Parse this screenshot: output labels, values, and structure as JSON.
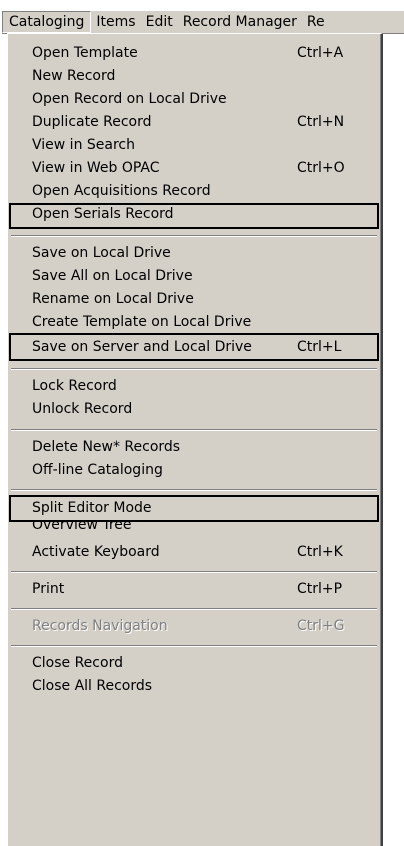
{
  "menubar": {
    "items": [
      {
        "label": "Cataloging"
      },
      {
        "label": "Items"
      },
      {
        "label": "Edit"
      },
      {
        "label": "Record Manager"
      },
      {
        "label": "Re"
      }
    ]
  },
  "menu": {
    "items": [
      {
        "label": "Open Template",
        "shortcut": "Ctrl+A"
      },
      {
        "label": "New Record",
        "shortcut": ""
      },
      {
        "label": "Open Record on Local Drive",
        "shortcut": ""
      },
      {
        "label": "Duplicate Record",
        "shortcut": "Ctrl+N"
      },
      {
        "label": "View in Search",
        "shortcut": ""
      },
      {
        "label": "View in Web OPAC",
        "shortcut": "Ctrl+O"
      },
      {
        "label": "Open Acquisitions Record",
        "shortcut": ""
      },
      {
        "label": "Open Serials Record",
        "shortcut": ""
      },
      {
        "label": "Save on Local Drive",
        "shortcut": ""
      },
      {
        "label": "Save All on Local Drive",
        "shortcut": ""
      },
      {
        "label": "Rename on Local Drive",
        "shortcut": ""
      },
      {
        "label": "Create Template on Local Drive",
        "shortcut": ""
      },
      {
        "label": "Save on Server and Local Drive",
        "shortcut": "Ctrl+L"
      },
      {
        "label": "Lock Record",
        "shortcut": ""
      },
      {
        "label": "Unlock Record",
        "shortcut": ""
      },
      {
        "label": "Delete New* Records",
        "shortcut": ""
      },
      {
        "label": "Off-line Cataloging",
        "shortcut": ""
      },
      {
        "label": "Split Editor Mode",
        "shortcut": ""
      },
      {
        "label": "Overview Tree",
        "shortcut": ""
      },
      {
        "label": "Activate Keyboard",
        "shortcut": "Ctrl+K"
      },
      {
        "label": "Print",
        "shortcut": "Ctrl+P"
      },
      {
        "label": "Records Navigation",
        "shortcut": "Ctrl+G"
      },
      {
        "label": "Close Record",
        "shortcut": ""
      },
      {
        "label": "Close All Records",
        "shortcut": ""
      }
    ]
  }
}
